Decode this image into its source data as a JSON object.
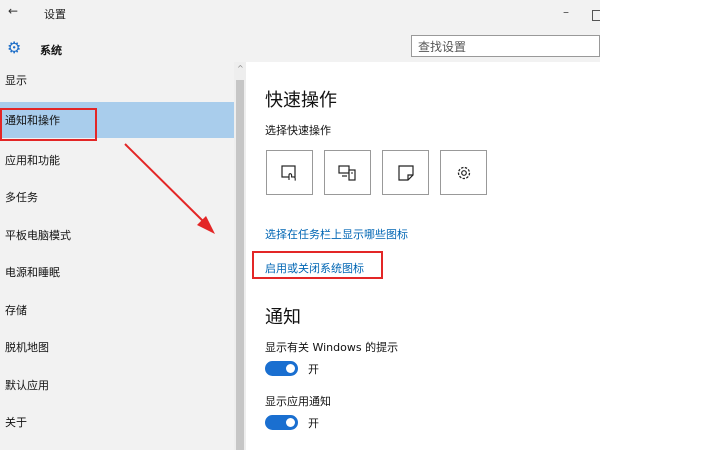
{
  "titlebar": {
    "back_icon": "back-arrow-icon",
    "title": "设置",
    "minimize_symbol": "–"
  },
  "header": {
    "icon": "gear-icon",
    "section_title": "系统",
    "search_placeholder": "查找设置"
  },
  "sidebar": {
    "items": [
      {
        "label": "显示",
        "selected": false
      },
      {
        "label": "通知和操作",
        "selected": true
      },
      {
        "label": "应用和功能",
        "selected": false
      },
      {
        "label": "多任务",
        "selected": false
      },
      {
        "label": "平板电脑模式",
        "selected": false
      },
      {
        "label": "电源和睡眠",
        "selected": false
      },
      {
        "label": "存储",
        "selected": false
      },
      {
        "label": "脱机地图",
        "selected": false
      },
      {
        "label": "默认应用",
        "selected": false
      },
      {
        "label": "关于",
        "selected": false
      }
    ]
  },
  "quick_actions": {
    "heading": "快速操作",
    "subheading": "选择快速操作",
    "tiles": [
      {
        "icon": "tablet-mode-icon"
      },
      {
        "icon": "project-display-icon"
      },
      {
        "icon": "note-icon"
      },
      {
        "icon": "settings-gear-icon"
      }
    ],
    "link_taskbar_icons": "选择在任务栏上显示哪些图标",
    "link_system_icons": "启用或关闭系统图标"
  },
  "notifications": {
    "heading": "通知",
    "windows_tips": {
      "label": "显示有关 Windows 的提示",
      "state": "开",
      "on": true
    },
    "app_notifications": {
      "label": "显示应用通知",
      "state": "开",
      "on": true
    }
  },
  "colors": {
    "accent": "#1a6fd0",
    "link": "#0066b4",
    "selected": "#a9cdec",
    "highlight": "#e32626",
    "sidebar_bg": "#f2f2f2"
  }
}
